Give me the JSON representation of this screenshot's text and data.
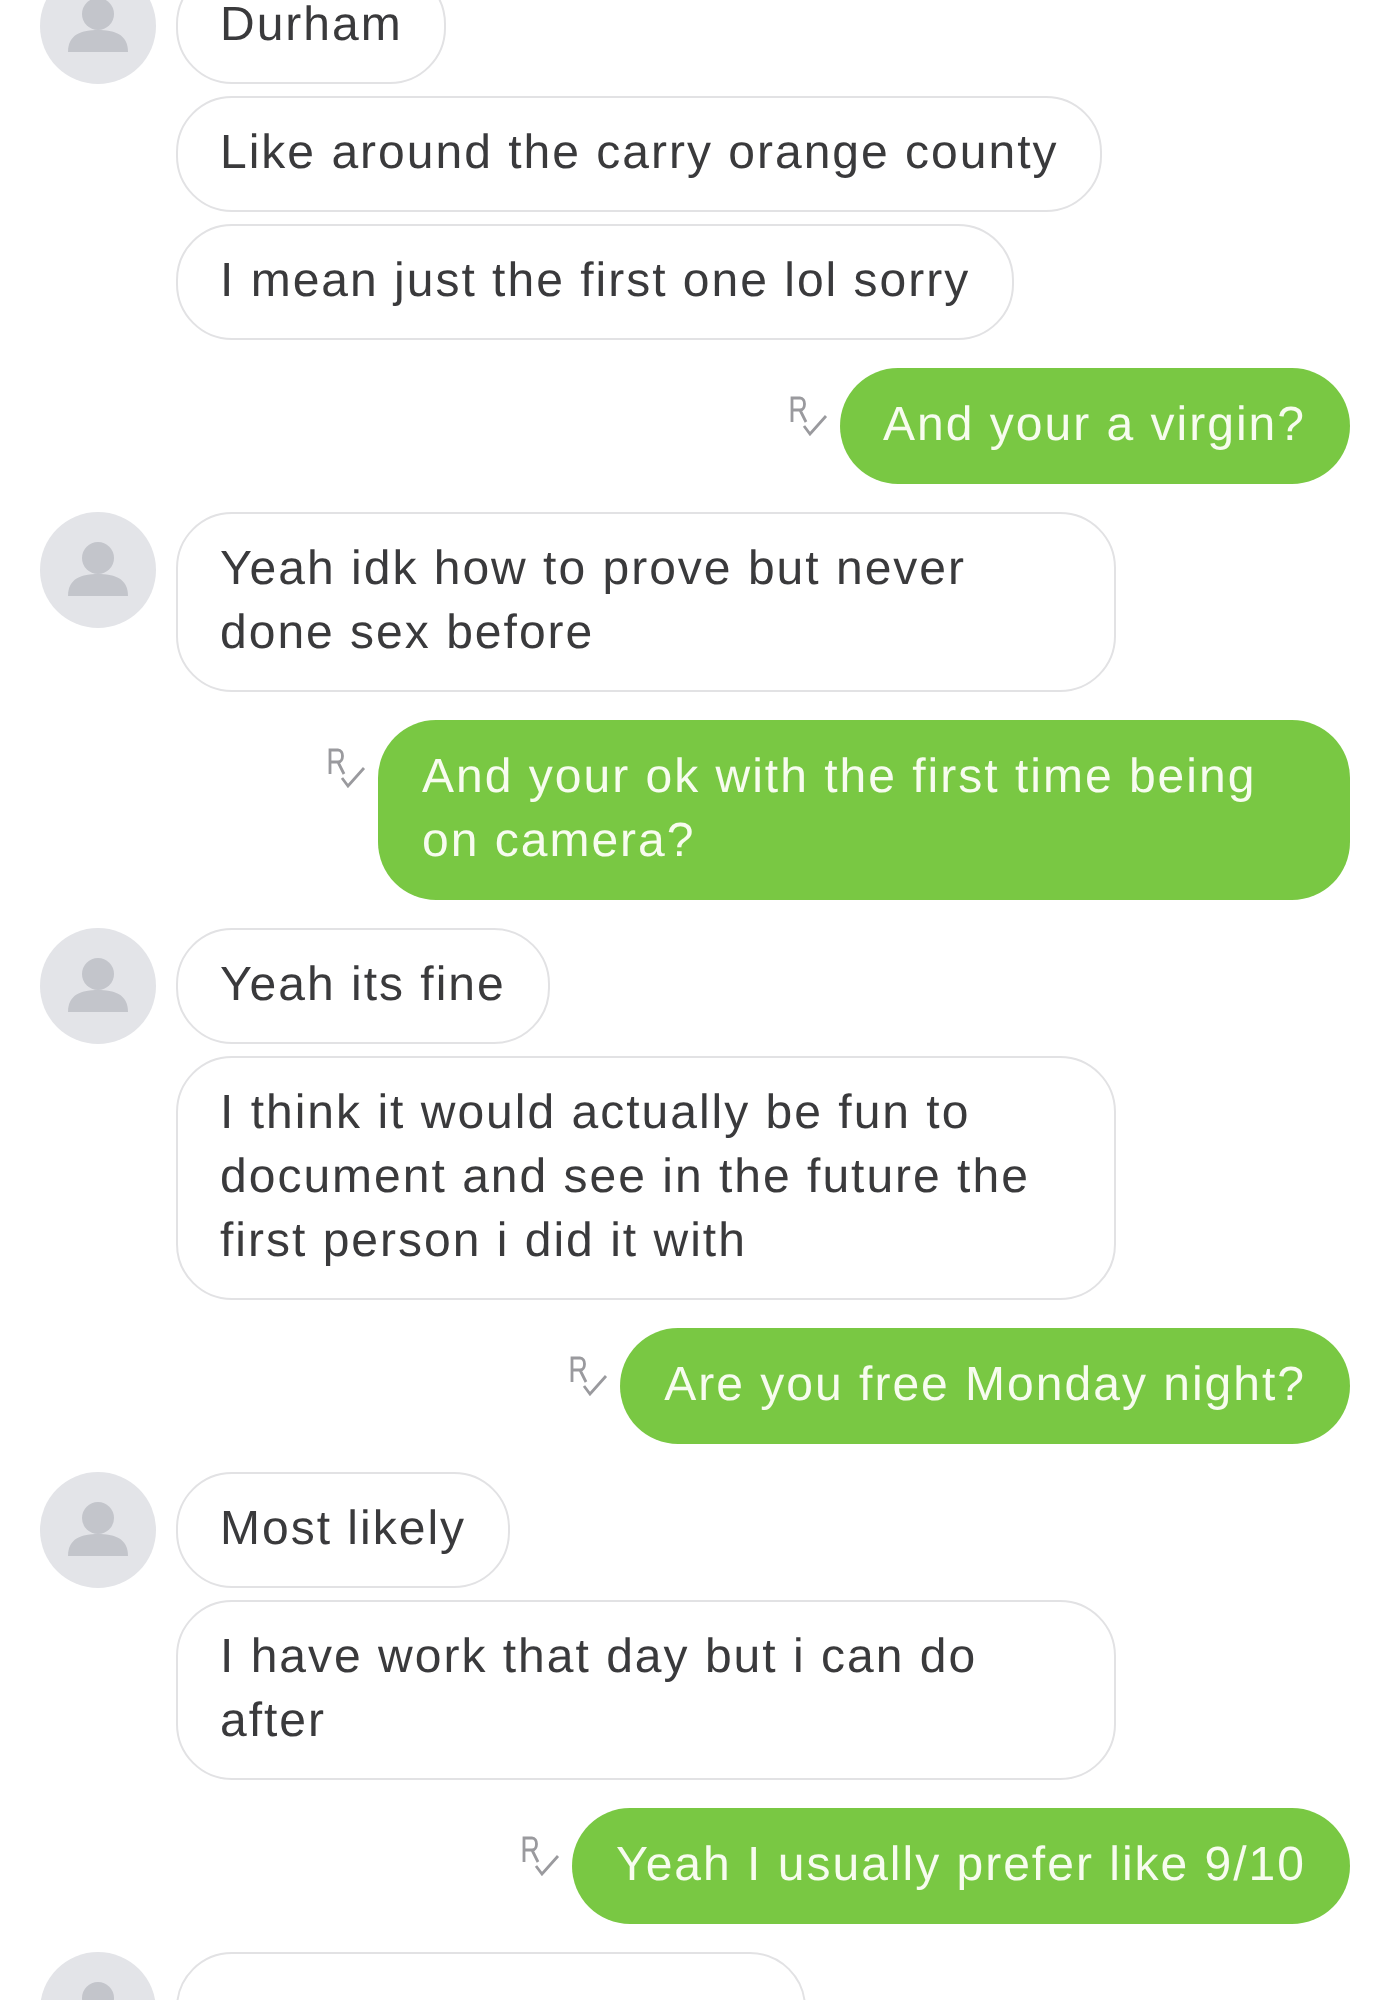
{
  "messages": [
    {
      "kind": "incoming",
      "avatar": true,
      "text": "Durham"
    },
    {
      "kind": "incoming",
      "avatar": false,
      "text": "Like around the carry orange county"
    },
    {
      "kind": "incoming",
      "avatar": false,
      "text": "I mean just the first one lol sorry"
    },
    {
      "kind": "outgoing",
      "read": true,
      "text": "And your a virgin?"
    },
    {
      "kind": "incoming",
      "avatar": true,
      "text": "Yeah idk how to prove but never done sex before"
    },
    {
      "kind": "outgoing",
      "read": true,
      "text": "And your ok with the first time being on camera?"
    },
    {
      "kind": "incoming",
      "avatar": true,
      "text": "Yeah its fine"
    },
    {
      "kind": "incoming",
      "avatar": false,
      "text": "I think it would actually be fun to document and see in the future the first person i did it with"
    },
    {
      "kind": "outgoing",
      "read": true,
      "text": "Are you free Monday night?"
    },
    {
      "kind": "incoming",
      "avatar": true,
      "text": "Most likely"
    },
    {
      "kind": "incoming",
      "avatar": false,
      "text": "I have work that day but i can do after"
    },
    {
      "kind": "outgoing",
      "read": true,
      "text": "Yeah I usually prefer like 9/10"
    },
    {
      "kind": "incoming",
      "avatar": true
    }
  ]
}
